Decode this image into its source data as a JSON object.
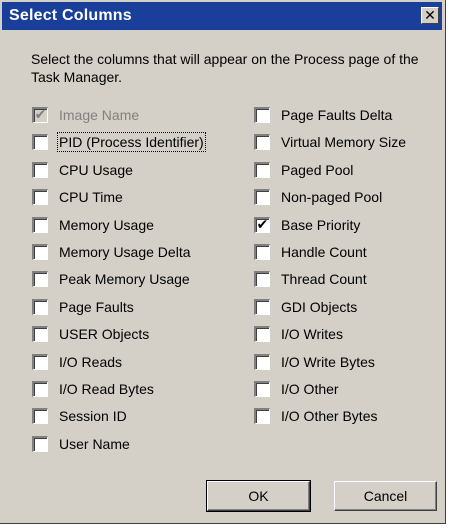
{
  "dialog": {
    "title": "Select Columns",
    "close_glyph": "✕",
    "instructions": "Select the columns that will appear on the Process page of the Task Manager.",
    "checkboxes_left": [
      {
        "label": "Image Name",
        "checked": true,
        "disabled": true
      },
      {
        "label": "PID (Process Identifier)",
        "checked": false,
        "disabled": false,
        "focused": true
      },
      {
        "label": "CPU Usage",
        "checked": false,
        "disabled": false
      },
      {
        "label": "CPU Time",
        "checked": false,
        "disabled": false
      },
      {
        "label": "Memory Usage",
        "checked": false,
        "disabled": false
      },
      {
        "label": "Memory Usage Delta",
        "checked": false,
        "disabled": false
      },
      {
        "label": "Peak Memory Usage",
        "checked": false,
        "disabled": false
      },
      {
        "label": "Page Faults",
        "checked": false,
        "disabled": false
      },
      {
        "label": "USER Objects",
        "checked": false,
        "disabled": false
      },
      {
        "label": "I/O Reads",
        "checked": false,
        "disabled": false
      },
      {
        "label": "I/O Read Bytes",
        "checked": false,
        "disabled": false
      },
      {
        "label": "Session ID",
        "checked": false,
        "disabled": false
      },
      {
        "label": "User Name",
        "checked": false,
        "disabled": false
      }
    ],
    "checkboxes_right": [
      {
        "label": "Page Faults Delta",
        "checked": false,
        "disabled": false
      },
      {
        "label": "Virtual Memory Size",
        "checked": false,
        "disabled": false
      },
      {
        "label": "Paged Pool",
        "checked": false,
        "disabled": false
      },
      {
        "label": "Non-paged Pool",
        "checked": false,
        "disabled": false
      },
      {
        "label": "Base Priority",
        "checked": true,
        "disabled": false
      },
      {
        "label": "Handle Count",
        "checked": false,
        "disabled": false
      },
      {
        "label": "Thread Count",
        "checked": false,
        "disabled": false
      },
      {
        "label": "GDI Objects",
        "checked": false,
        "disabled": false
      },
      {
        "label": "I/O Writes",
        "checked": false,
        "disabled": false
      },
      {
        "label": "I/O Write Bytes",
        "checked": false,
        "disabled": false
      },
      {
        "label": "I/O Other",
        "checked": false,
        "disabled": false
      },
      {
        "label": "I/O Other Bytes",
        "checked": false,
        "disabled": false
      }
    ],
    "check_glyph": "✔",
    "ok_label": "OK",
    "cancel_label": "Cancel"
  },
  "colors": {
    "title_bar": "#1a3f9a",
    "face": "#d4d0c8",
    "disabled_text": "#808080"
  }
}
